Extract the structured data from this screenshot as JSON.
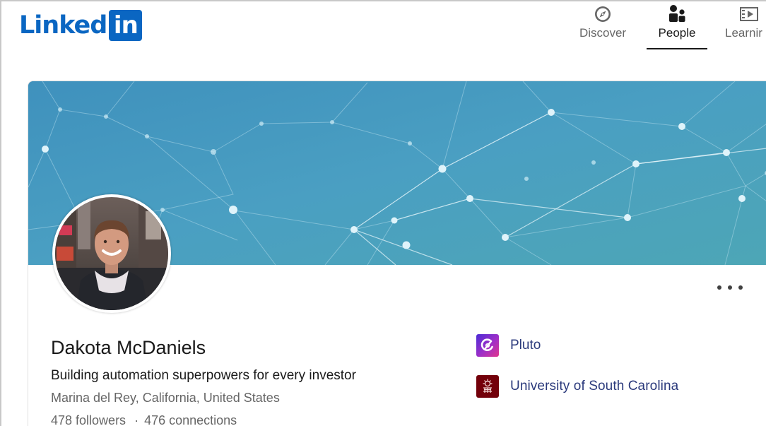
{
  "brand": {
    "logo_text": "Linked",
    "logo_box_text": "in",
    "color": "#0a66c2"
  },
  "nav": {
    "items": [
      {
        "label": "Discover",
        "icon": "compass-icon",
        "active": false
      },
      {
        "label": "People",
        "icon": "people-icon",
        "active": true
      },
      {
        "label": "Learnir",
        "icon": "video-play-icon",
        "active": false
      }
    ]
  },
  "profile": {
    "name": "Dakota McDaniels",
    "headline": "Building automation superpowers for every investor",
    "location": "Marina del Rey, California, United States",
    "followers": "478 followers",
    "separator": "·",
    "connections": "476 connections",
    "banner_color": "#4a9cc0",
    "more_icon": "more-horizontal-icon"
  },
  "organizations": [
    {
      "name": "Pluto",
      "logo": "pluto-logo-icon"
    },
    {
      "name": "University of South Carolina",
      "logo": "usc-logo-icon",
      "color": "#73000a"
    }
  ]
}
